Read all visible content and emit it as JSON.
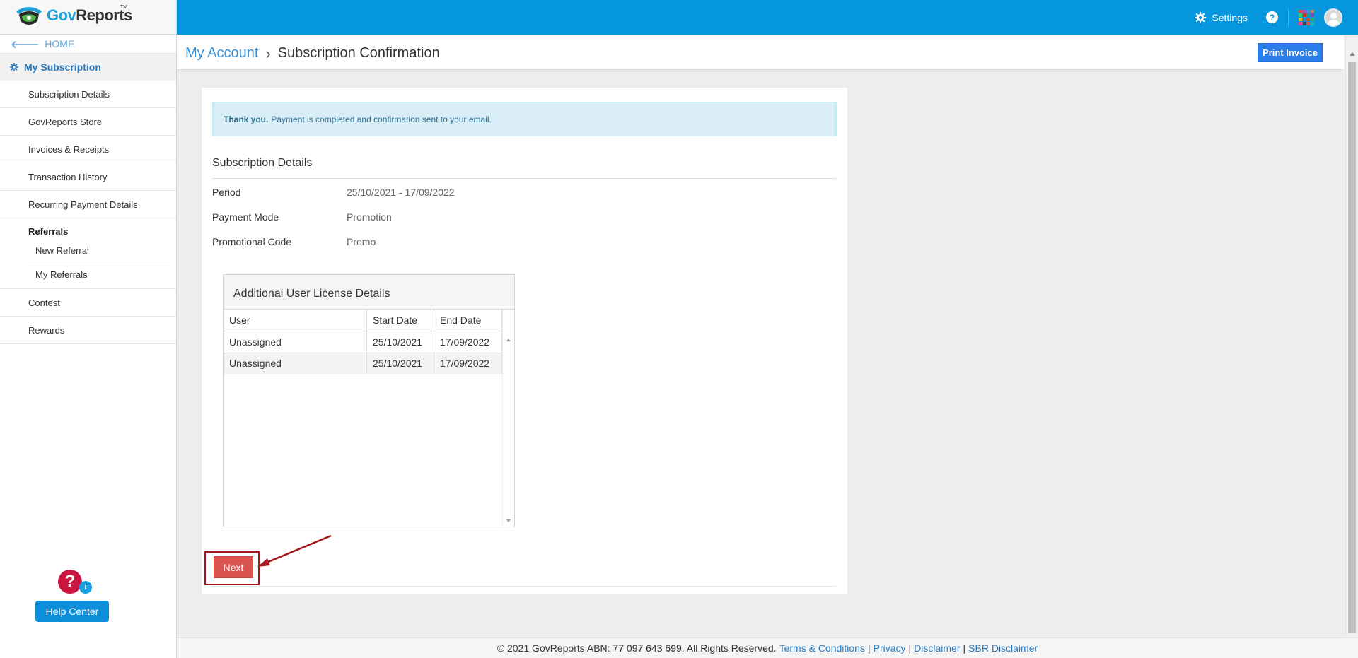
{
  "app": {
    "logo_gov": "Gov",
    "logo_reports": "Reports",
    "logo_tm": "TM"
  },
  "topbar": {
    "settings_label": "Settings",
    "help_label": "?"
  },
  "sidebar": {
    "home_label": "HOME",
    "section_label": "My Subscription",
    "items": [
      {
        "label": "Subscription Details"
      },
      {
        "label": "GovReports Store"
      },
      {
        "label": "Invoices & Receipts"
      },
      {
        "label": "Transaction History"
      },
      {
        "label": "Recurring Payment Details"
      }
    ],
    "referrals": {
      "title": "Referrals",
      "items": [
        {
          "label": "New Referral"
        },
        {
          "label": "My Referrals"
        }
      ]
    },
    "items_after": [
      {
        "label": "Contest"
      },
      {
        "label": "Rewards"
      }
    ],
    "help_center_label": "Help Center"
  },
  "header": {
    "breadcrumb_parent": "My Account",
    "breadcrumb_current": "Subscription Confirmation",
    "print_invoice_label": "Print Invoice"
  },
  "confirmation": {
    "alert_bold": "Thank you.",
    "alert_text": "Payment is completed and confirmation sent to your email.",
    "section_title": "Subscription Details",
    "details": [
      {
        "label": "Period",
        "value": "25/10/2021 - 17/09/2022"
      },
      {
        "label": "Payment Mode",
        "value": "Promotion"
      },
      {
        "label": "Promotional Code",
        "value": "Promo"
      }
    ],
    "license_panel": {
      "title": "Additional User License Details",
      "columns": [
        "User",
        "Start Date",
        "End Date"
      ],
      "rows": [
        [
          "Unassigned",
          "25/10/2021",
          "17/09/2022"
        ],
        [
          "Unassigned",
          "25/10/2021",
          "17/09/2022"
        ]
      ]
    },
    "next_label": "Next"
  },
  "footer": {
    "copyright": "© 2021 GovReports ABN: 77 097 643 699. All Rights Reserved.",
    "links": [
      "Terms & Conditions",
      "Privacy",
      "Disclaimer",
      "SBR Disclaimer"
    ]
  },
  "colors": {
    "topbar": "#0696de",
    "accent_blue": "#2b7de9",
    "next_red": "#d9534f",
    "annotation_red": "#a6141c"
  }
}
